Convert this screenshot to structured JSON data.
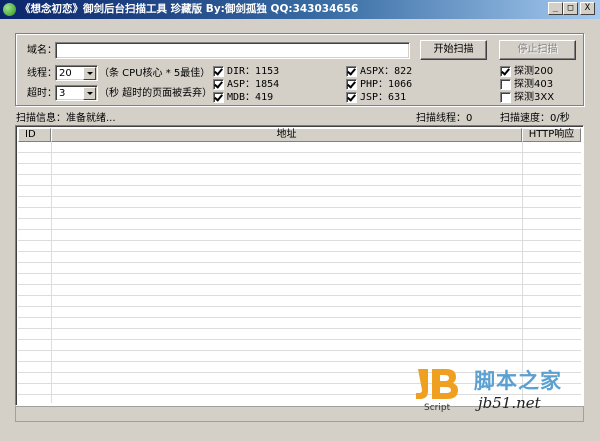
{
  "window": {
    "title": "《想念初恋》御剑后台扫描工具 珍藏版 By:御剑孤独 QQ:343034656",
    "minimize_glyph": "_",
    "maximize_glyph": "□",
    "close_glyph": "X"
  },
  "form": {
    "domain_label": "域名：",
    "domain_value": "",
    "threads_label": "线程：",
    "threads_value": "20",
    "threads_hint": "（条 CPU核心 * 5最佳）",
    "timeout_label": "超时：",
    "timeout_value": "3",
    "timeout_hint": "（秒 超时的页面被丢弃）",
    "start_button": "开始扫描",
    "stop_button": "停止扫描"
  },
  "dictionaries": [
    {
      "label": "DIR：1153",
      "checked": true
    },
    {
      "label": "ASP：1854",
      "checked": true
    },
    {
      "label": "MDB：419",
      "checked": true
    },
    {
      "label": "ASPX：822",
      "checked": true
    },
    {
      "label": "PHP：1066",
      "checked": true
    },
    {
      "label": "JSP：631",
      "checked": true
    }
  ],
  "probes": [
    {
      "label": "探测200",
      "checked": true
    },
    {
      "label": "探测403",
      "checked": false
    },
    {
      "label": "探测3XX",
      "checked": false
    }
  ],
  "status": {
    "info": "扫描信息：准备就绪...",
    "threads": "扫描线程：0",
    "speed": "扫描速度：0/秒"
  },
  "results_table": {
    "columns": [
      "ID",
      "地址",
      "HTTP响应"
    ],
    "rows": []
  },
  "watermark": {
    "logo_text": "JB",
    "logo_sub": "Script",
    "site": "脚本之家",
    "domain": "jb51.net",
    "accent": "#f0a020"
  }
}
